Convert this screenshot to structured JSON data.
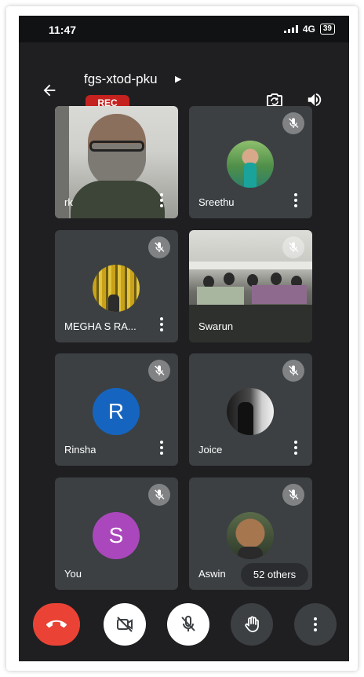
{
  "status": {
    "time": "11:47",
    "network": "4G",
    "battery": "39"
  },
  "header": {
    "title": "fgs-xtod-pku",
    "rec_label": "REC"
  },
  "participants": [
    {
      "name": "rk",
      "muted": false,
      "kind": "video"
    },
    {
      "name": "Sreethu",
      "muted": true,
      "kind": "photo"
    },
    {
      "name": "MEGHA S RA...",
      "muted": true,
      "kind": "photo"
    },
    {
      "name": "Swarun",
      "muted": true,
      "kind": "video"
    },
    {
      "name": "Rinsha",
      "muted": true,
      "kind": "letter",
      "letter": "R",
      "color": "#1565c0"
    },
    {
      "name": "Joice",
      "muted": true,
      "kind": "photo"
    },
    {
      "name": "You",
      "muted": true,
      "kind": "letter",
      "letter": "S",
      "color": "#ab47bc"
    },
    {
      "name": "Aswin",
      "muted": true,
      "kind": "photo"
    }
  ],
  "others_label": "52 others",
  "colors": {
    "background": "#1f1f21",
    "tile": "#3c4043",
    "end_call": "#ea4335",
    "rec": "#c5221f"
  },
  "icons": [
    "back-arrow-icon",
    "flip-camera-icon",
    "speaker-icon",
    "mic-off-icon",
    "more-vert-icon",
    "end-call-icon",
    "camera-off-icon",
    "raise-hand-icon"
  ]
}
